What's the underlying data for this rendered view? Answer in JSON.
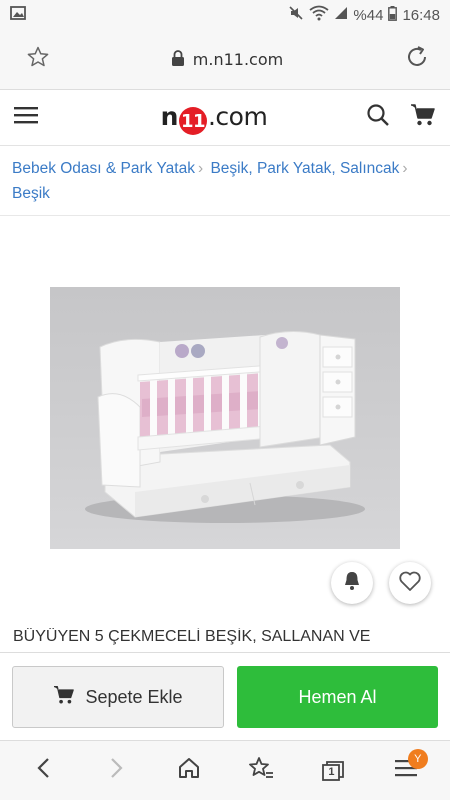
{
  "status": {
    "percent": "%44",
    "time": "16:48"
  },
  "browser": {
    "url": "m.n11.com"
  },
  "site": {
    "logo_prefix": "n",
    "logo_digits": "11",
    "logo_suffix": ".com"
  },
  "breadcrumb": {
    "items": [
      "Bebek Odası & Park Yatak",
      "Beşik, Park Yatak, Salıncak",
      "Beşik"
    ]
  },
  "product": {
    "title": "BÜYÜYEN 5 ÇEKMECELİ BEŞİK, SALLANAN VE"
  },
  "actions": {
    "add_to_cart": "Sepete Ekle",
    "buy_now": "Hemen Al"
  },
  "nav": {
    "tabs_count": "1",
    "menu_badge": "Y"
  },
  "colors": {
    "accent_green": "#2ebd3b",
    "link_blue": "#3b7bc6",
    "logo_red": "#e41e26",
    "badge_orange": "#f07d1e"
  }
}
